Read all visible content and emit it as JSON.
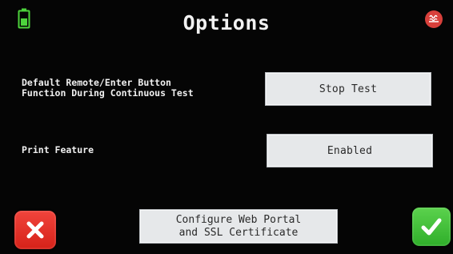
{
  "header": {
    "title": "Options",
    "battery_icon": "battery-icon",
    "heater_icon": "heater-icon"
  },
  "settings": [
    {
      "label": "Default Remote/Enter Button\nFunction During Continuous Test",
      "value": "Stop Test"
    },
    {
      "label": "Print Feature",
      "value": "Enabled"
    }
  ],
  "footer": {
    "config_line1": "Configure Web Portal",
    "config_line2": "and SSL Certificate",
    "cancel_icon": "close-icon",
    "confirm_icon": "checkmark-icon"
  },
  "colors": {
    "background": "#050505",
    "button": "#e6e8ea",
    "cancel": "#e32d23",
    "confirm": "#45c33b",
    "battery": "#4dd33c",
    "heater": "#d8403b"
  }
}
